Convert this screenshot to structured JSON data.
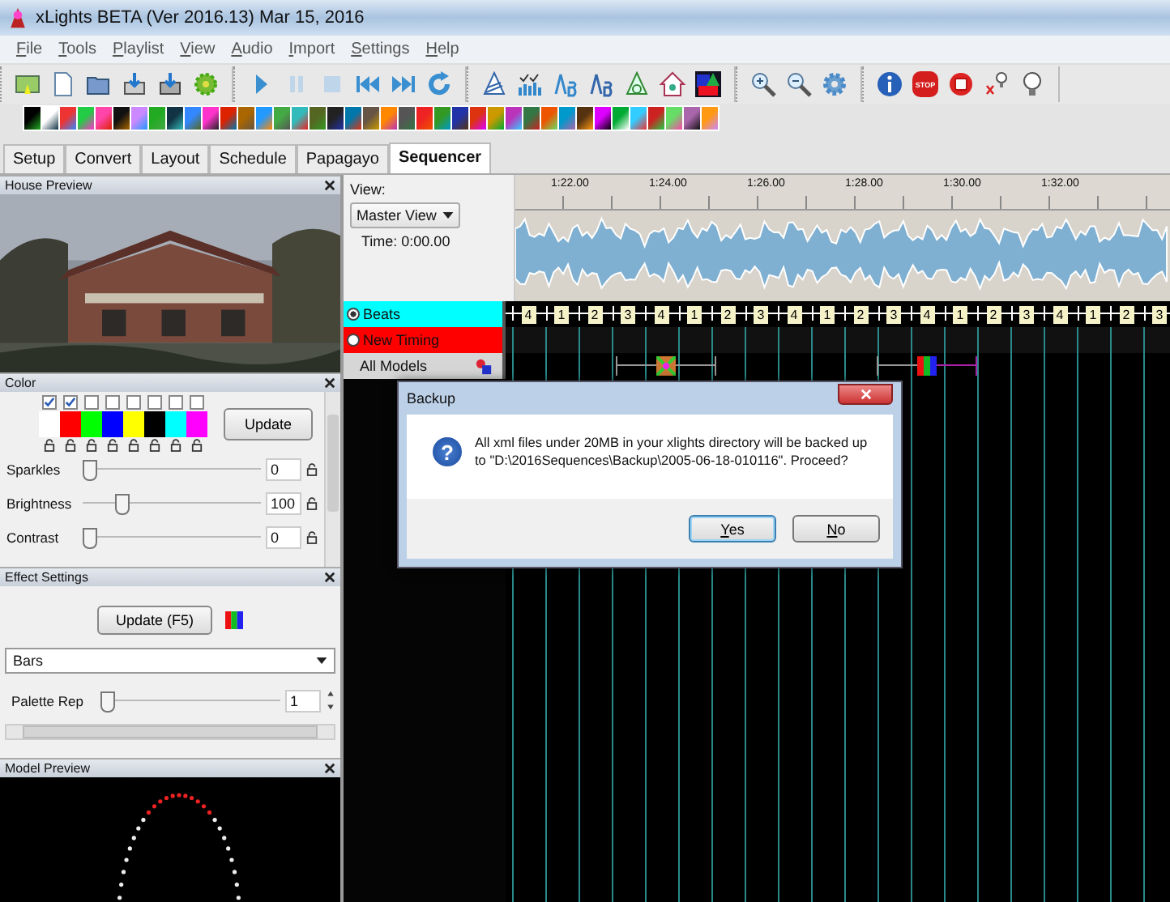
{
  "window": {
    "title": "xLights BETA (Ver 2016.13) Mar 15, 2016"
  },
  "menu": [
    "File",
    "Tools",
    "Playlist",
    "View",
    "Audio",
    "Import",
    "Settings",
    "Help"
  ],
  "toolbar": {
    "stop_label": "STOP"
  },
  "tabs": [
    {
      "label": "Setup",
      "selected": false
    },
    {
      "label": "Convert",
      "selected": false
    },
    {
      "label": "Layout",
      "selected": false
    },
    {
      "label": "Schedule",
      "selected": false
    },
    {
      "label": "Papagayo",
      "selected": false
    },
    {
      "label": "Sequencer",
      "selected": true
    }
  ],
  "house_preview": {
    "title": "House Preview"
  },
  "color_panel": {
    "title": "Color",
    "update_button": "Update",
    "swatches": [
      {
        "color": "#ffffff",
        "checked": true
      },
      {
        "color": "#ff0000",
        "checked": true
      },
      {
        "color": "#00ff00",
        "checked": false
      },
      {
        "color": "#0000ff",
        "checked": false
      },
      {
        "color": "#ffff00",
        "checked": false
      },
      {
        "color": "#000000",
        "checked": false
      },
      {
        "color": "#00ffff",
        "checked": false
      },
      {
        "color": "#ff00ff",
        "checked": false
      }
    ],
    "sliders": [
      {
        "label": "Sparkles",
        "level": 0,
        "value": "0"
      },
      {
        "label": "Brightness",
        "level": 0.2,
        "value": "100"
      },
      {
        "label": "Contrast",
        "level": 0,
        "value": "0"
      }
    ]
  },
  "effect_settings": {
    "title": "Effect Settings",
    "update_button": "Update (F5)",
    "effect": "Bars",
    "palette_rep": {
      "label": "Palette Rep",
      "level": 0,
      "value": "1"
    }
  },
  "model_preview": {
    "title": "Model Preview"
  },
  "sequencer": {
    "view_label": "View:",
    "view": "Master View",
    "time": "Time: 0:00.00",
    "ruler": [
      "1:22.00",
      "1:24.00",
      "1:26.00",
      "1:28.00",
      "1:30.00",
      "1:32.00"
    ],
    "rows": [
      {
        "label": "Beats",
        "kind": "timing",
        "color": "#00ffff",
        "selected": true
      },
      {
        "label": "New Timing",
        "kind": "timing",
        "color": "#ff0000",
        "selected": false
      },
      {
        "label": "All Models",
        "kind": "model"
      }
    ],
    "beats": [
      "4",
      "1",
      "2",
      "3",
      "4",
      "1",
      "2",
      "3",
      "4",
      "1",
      "2",
      "3",
      "4",
      "1",
      "2",
      "3",
      "4",
      "1",
      "2",
      "3"
    ]
  },
  "dialog": {
    "title": "Backup",
    "icon_glyph": "?",
    "message": "All xml files under 20MB in your xlights directory will be backed up to \"D:\\2016Sequences\\Backup\\2005-06-18-010116\". Proceed?",
    "buttons": [
      {
        "label": "Yes",
        "selected": true
      },
      {
        "label": "No",
        "selected": false
      }
    ]
  }
}
